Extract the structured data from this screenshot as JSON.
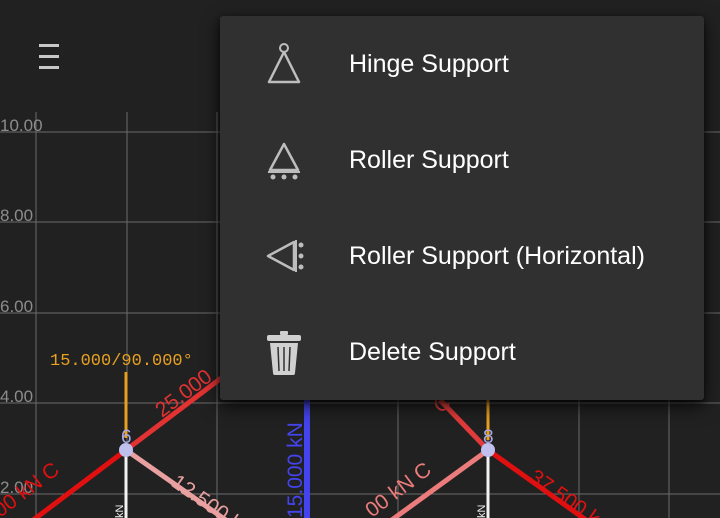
{
  "canvas": {
    "y_tick_labels": [
      "10.00",
      "8.00",
      "6.00",
      "4.00",
      "2.00"
    ],
    "force_label": "15.000/90.000°",
    "node_labels": [
      "6",
      "8"
    ],
    "member_labels": [
      "25.000",
      "12.500 k",
      "15.000 kN",
      "00 kN C",
      "00 kN C",
      "37.500 k",
      "C",
      "kN",
      "kN"
    ]
  },
  "menu": {
    "items": [
      {
        "label": "Hinge Support",
        "icon": "hinge-support-icon"
      },
      {
        "label": "Roller Support",
        "icon": "roller-support-icon"
      },
      {
        "label": "Roller Support (Horizontal)",
        "icon": "roller-support-horizontal-icon"
      },
      {
        "label": "Delete Support",
        "icon": "trash-icon"
      }
    ]
  },
  "colors": {
    "background": "#212121",
    "grid": "#6b6b6b",
    "popup": "#303030",
    "force": "#e8a020",
    "tension": "#e06060",
    "compression": "#e01010",
    "vertical_member": "#4444ee",
    "node": "#c0c0ee"
  }
}
